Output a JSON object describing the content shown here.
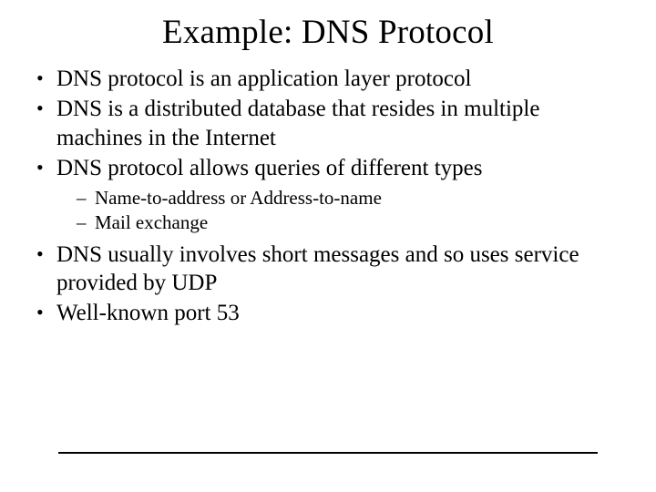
{
  "title": "Example:  DNS Protocol",
  "bullets": {
    "b0": "DNS protocol is an application layer protocol",
    "b1": "DNS is a distributed database that resides in multiple machines in the Internet",
    "b2": "DNS protocol allows queries of different types",
    "b2_sub": {
      "s0": "Name-to-address or Address-to-name",
      "s1": "Mail exchange"
    },
    "b3": "DNS usually involves short messages and so uses service provided by UDP",
    "b4": "Well-known port 53"
  }
}
